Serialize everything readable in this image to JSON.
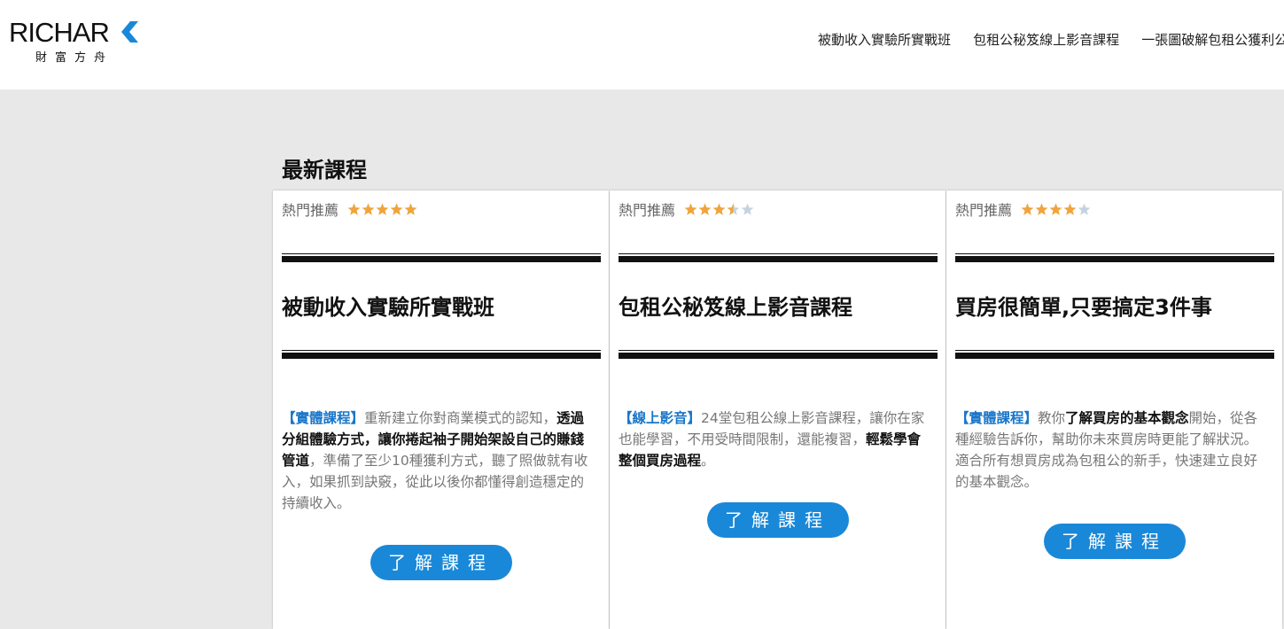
{
  "brand": {
    "name": "RICHAR",
    "subtitle": "財富方舟"
  },
  "nav": {
    "items": [
      "被動收入實驗所實戰班",
      "包租公秘笈線上影音課程",
      "一張圖破解包租公獲利公式"
    ]
  },
  "section": {
    "title": "最新課程"
  },
  "cards": [
    {
      "recommend": "熱門推薦",
      "rating": 5,
      "title": "被動收入實驗所實戰班",
      "desc": {
        "tag": "【實體課程】",
        "t1": "重新建立你對商業模式的認知，",
        "b1": "透過分組體驗方式，讓你捲起袖子開始架設自己的賺錢管道",
        "t2": "，準備了至少10種獲利方式，聽了照做就有收入，如果抓到訣竅，從此以後你都懂得創造穩定的持續收入。",
        "b2": "",
        "t3": ""
      },
      "cta": "了解課程"
    },
    {
      "recommend": "熱門推薦",
      "rating": 3.5,
      "title": "包租公秘笈線上影音課程",
      "desc": {
        "tag": "【線上影音】",
        "t1": "24堂包租公線上影音課程，讓你在家也能學習，不用受時間限制，還能複習，",
        "b1": "輕鬆學會整個買房過程",
        "t2": "。",
        "b2": "",
        "t3": ""
      },
      "cta": "了解課程"
    },
    {
      "recommend": "熱門推薦",
      "rating": 4,
      "title": "買房很簡單,只要搞定3件事",
      "desc": {
        "tag": "【實體課程】",
        "t1": "教你",
        "b1": "了解買房的基本觀念",
        "t2": "開始，從各種經驗告訴你，幫助你未來買房時更能了解狀況。適合所有想買房成為包租公的新手，快速建立良好的基本觀念。",
        "b2": "",
        "t3": ""
      },
      "cta": "了解課程"
    }
  ],
  "colors": {
    "accent": "#1a88d8",
    "tag": "#1976c9",
    "star_on": "#f0a43a",
    "star_off": "#c5d3e0",
    "background": "#e8e8e8"
  },
  "icons": {
    "rating": "star-icon",
    "logo": "richark-k-mark"
  }
}
